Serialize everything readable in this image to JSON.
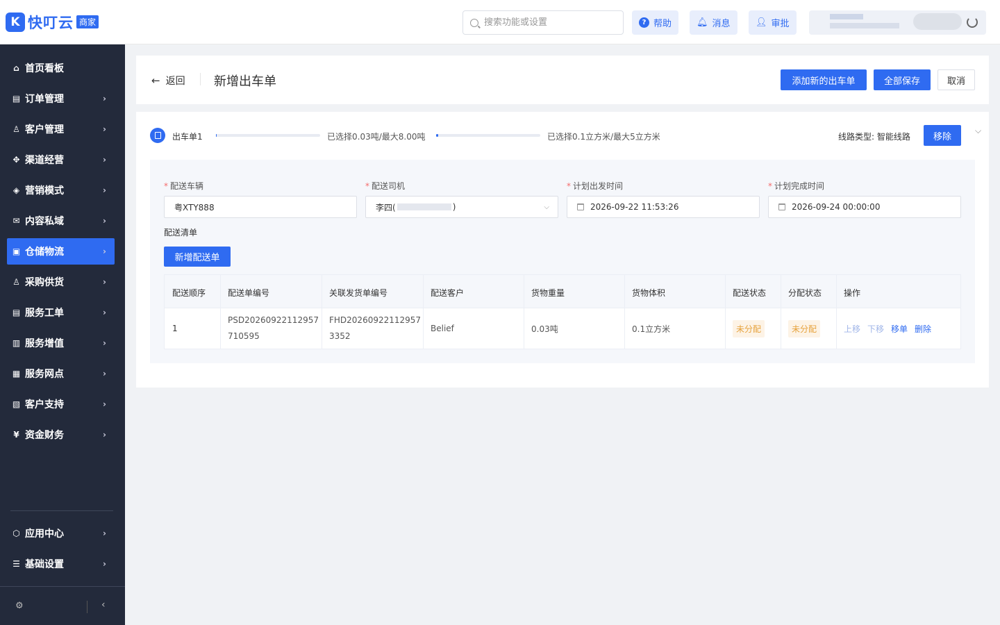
{
  "header": {
    "logo_text": "快叮云",
    "logo_badge": "商家",
    "search_placeholder": "搜索功能或设置",
    "help_label": "帮助",
    "messages_label": "消息",
    "approve_label": "审批"
  },
  "sidebar": {
    "items": [
      {
        "label": "首页看板",
        "icon": "home-icon",
        "glyph": "⌂"
      },
      {
        "label": "订单管理",
        "icon": "document-icon",
        "glyph": "▤"
      },
      {
        "label": "客户管理",
        "icon": "user-icon",
        "glyph": "♙"
      },
      {
        "label": "渠道经营",
        "icon": "network-icon",
        "glyph": "✥"
      },
      {
        "label": "营销模式",
        "icon": "tag-icon",
        "glyph": "◈"
      },
      {
        "label": "内容私域",
        "icon": "mail-icon",
        "glyph": "✉"
      },
      {
        "label": "仓储物流",
        "icon": "warehouse-icon",
        "glyph": "▣"
      },
      {
        "label": "采购供货",
        "icon": "purchase-icon",
        "glyph": "♙"
      },
      {
        "label": "服务工单",
        "icon": "ticket-icon",
        "glyph": "▤"
      },
      {
        "label": "服务增值",
        "icon": "gift-icon",
        "glyph": "▥"
      },
      {
        "label": "服务网点",
        "icon": "store-icon",
        "glyph": "▦"
      },
      {
        "label": "客户支持",
        "icon": "support-icon",
        "glyph": "▧"
      },
      {
        "label": "资金财务",
        "icon": "yen-icon",
        "glyph": "¥"
      }
    ],
    "bottom_items": [
      {
        "label": "应用中心",
        "icon": "cube-icon",
        "glyph": "⬡"
      },
      {
        "label": "基础设置",
        "icon": "settings-icon",
        "glyph": "☰"
      }
    ],
    "active_index": 6
  },
  "page": {
    "back_label": "返回",
    "title": "新增出车单",
    "add_order_button": "添加新的出车单",
    "save_all_button": "全部保存",
    "cancel_button": "取消"
  },
  "order": {
    "label": "出车单1",
    "weight_text": "已选择0.03吨/最大8.00吨",
    "weight_fraction": 0.00375,
    "volume_text": "已选择0.1立方米/最大5立方米",
    "volume_fraction": 0.02,
    "route_type": "线路类型: 智能线路",
    "remove_button": "移除",
    "form": {
      "vehicle_label": "配送车辆",
      "vehicle_value": "粤XTY888",
      "driver_label": "配送司机",
      "driver_value_prefix": "李四(",
      "driver_value_suffix": ")",
      "start_label": "计划出发时间",
      "start_value": "2026-09-22 11:53:26",
      "end_label": "计划完成时间",
      "end_value": "2026-09-24 00:00:00"
    },
    "list_label": "配送清单",
    "add_delivery_button": "新增配送单",
    "table": {
      "headers": [
        "配送顺序",
        "配送单编号",
        "关联发货单编号",
        "配送客户",
        "货物重量",
        "货物体积",
        "配送状态",
        "分配状态",
        "操作"
      ],
      "rows": [
        {
          "seq": "1",
          "delivery_no_1": "PSD20260922112957",
          "delivery_no_2": "710595",
          "shipment_no_1": "FHD20260922112957",
          "shipment_no_2": "3352",
          "customer": "Belief",
          "weight": "0.03吨",
          "volume": "0.1立方米",
          "delivery_status": "未分配",
          "assign_status": "未分配",
          "ops": [
            "上移",
            "下移",
            "移单",
            "删除"
          ]
        }
      ]
    }
  }
}
